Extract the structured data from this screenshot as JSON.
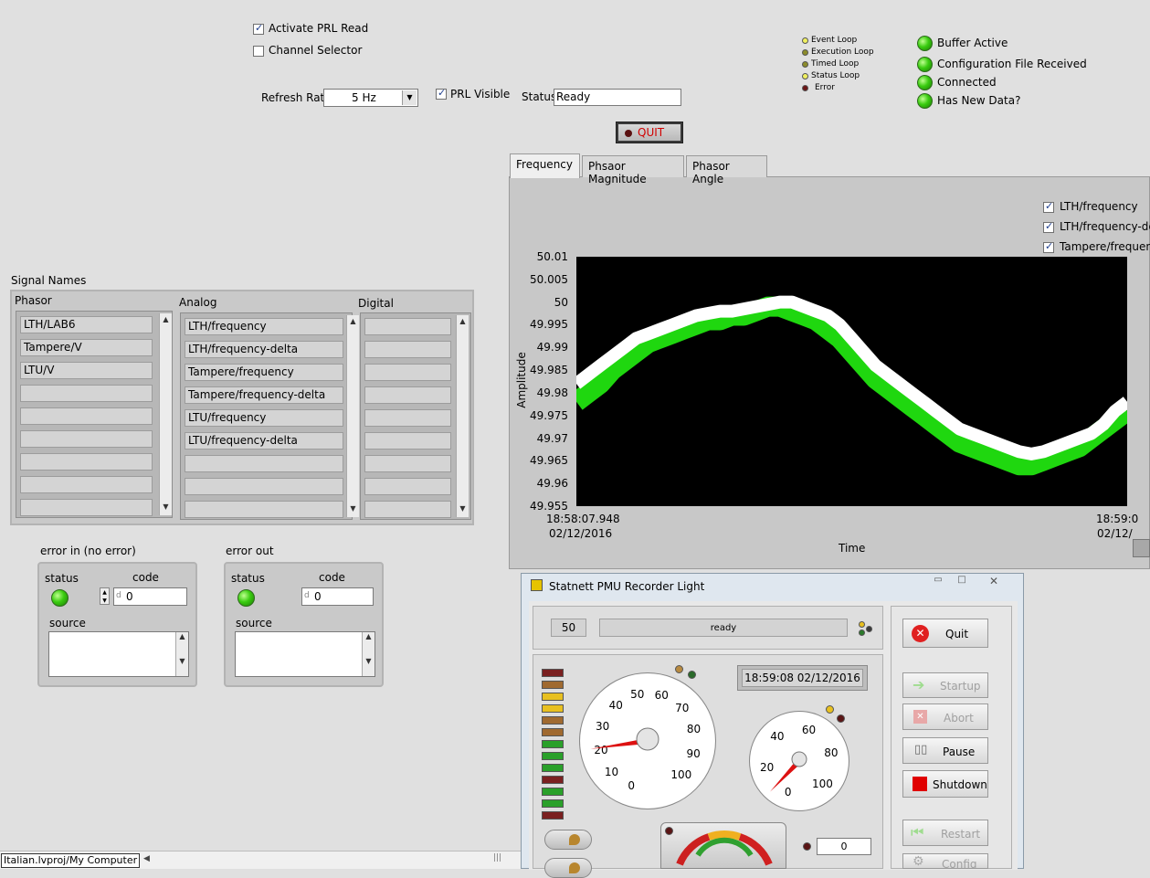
{
  "controls": {
    "activate_prl_read": "Activate PRL Read",
    "channel_selector": "Channel Selector",
    "refresh_rate_label": "Refresh Rate",
    "refresh_rate_value": "5 Hz",
    "prl_visible": "PRL Visible",
    "status_label": "Status",
    "status_value": "Ready",
    "quit_label": "QUIT"
  },
  "loops": [
    "Event Loop",
    "Execution Loop",
    "Timed Loop",
    "Status Loop",
    "Error"
  ],
  "indicators": [
    "Buffer Active",
    "Configuration File Received",
    "Connected",
    "Has New Data?"
  ],
  "signals": {
    "title": "Signal Names",
    "phasor_header": "Phasor",
    "analog_header": "Analog",
    "digital_header": "Digital",
    "phasor": [
      "LTH/LAB6",
      "Tampere/V",
      "LTU/V"
    ],
    "analog": [
      "LTH/frequency",
      "LTH/frequency-delta",
      "Tampere/frequency",
      "Tampere/frequency-delta",
      "LTU/frequency",
      "LTU/frequency-delta"
    ]
  },
  "error_in": {
    "title": "error in (no error)",
    "status": "status",
    "code_label": "code",
    "code": "0",
    "source": "source",
    "radix": "d"
  },
  "error_out": {
    "title": "error out",
    "status": "status",
    "code_label": "code",
    "code": "0",
    "source": "source",
    "radix": "d"
  },
  "tabs": [
    "Frequency",
    "Phsaor Magnitude",
    "Phasor Angle"
  ],
  "legend": [
    "LTH/frequency",
    "LTH/frequency-de",
    "Tampere/frequenc"
  ],
  "chart_data": {
    "type": "line",
    "xlabel": "Time",
    "ylabel": "Amplitude",
    "ylim": [
      49.955,
      50.01
    ],
    "yticks": [
      "50.01",
      "50.005",
      "50",
      "49.995",
      "49.99",
      "49.985",
      "49.98",
      "49.975",
      "49.97",
      "49.965",
      "49.96",
      "49.955"
    ],
    "xticks": [
      {
        "time": "18:58:07.948",
        "date": "02/12/2016"
      },
      {
        "time": "18:59:0",
        "date": "02/12/"
      }
    ],
    "series": [
      {
        "color": "#ffffff",
        "values": [
          49.982,
          49.984,
          49.986,
          49.988,
          49.99,
          49.992,
          49.993,
          49.994,
          49.995,
          49.996,
          49.997,
          49.9975,
          49.998,
          49.998,
          49.9985,
          49.999,
          49.9995,
          50.0,
          50.0,
          49.999,
          49.998,
          49.997,
          49.995,
          49.992,
          49.989,
          49.986,
          49.984,
          49.982,
          49.98,
          49.978,
          49.976,
          49.974,
          49.972,
          49.971,
          49.97,
          49.969,
          49.968,
          49.967,
          49.9665,
          49.967,
          49.968,
          49.969,
          49.97,
          49.971,
          49.973,
          49.976,
          49.978
        ]
      },
      {
        "color": "#22ee11",
        "values": [
          49.978,
          49.98,
          49.982,
          49.985,
          49.987,
          49.989,
          49.991,
          49.992,
          49.993,
          49.994,
          49.995,
          49.996,
          49.996,
          49.997,
          49.997,
          49.998,
          49.999,
          49.999,
          49.998,
          49.997,
          49.996,
          49.994,
          49.992,
          49.989,
          49.986,
          49.983,
          49.981,
          49.979,
          49.977,
          49.975,
          49.973,
          49.971,
          49.969,
          49.968,
          49.967,
          49.966,
          49.965,
          49.964,
          49.964,
          49.965,
          49.966,
          49.967,
          49.968,
          49.97,
          49.972,
          49.974,
          49.976
        ]
      }
    ]
  },
  "pmu": {
    "title": "Statnett PMU Recorder Light",
    "count": "50",
    "status": "ready",
    "datetime": "18:59:08  02/12/2016",
    "quit": "Quit",
    "startup": "Startup",
    "abort": "Abort",
    "pause": "Pause",
    "shutdown": "Shutdown",
    "restart": "Restart",
    "config": "Config",
    "small_value": "0",
    "gauge1": {
      "labels": [
        "0",
        "10",
        "20",
        "30",
        "40",
        "50",
        "60",
        "70",
        "80",
        "90",
        "100"
      ],
      "value": 21
    },
    "gauge2": {
      "labels": [
        "0",
        "20",
        "40",
        "60",
        "80",
        "100"
      ],
      "value": 8
    }
  },
  "taskbar": {
    "project": "Italian.lvproj/My Computer"
  }
}
